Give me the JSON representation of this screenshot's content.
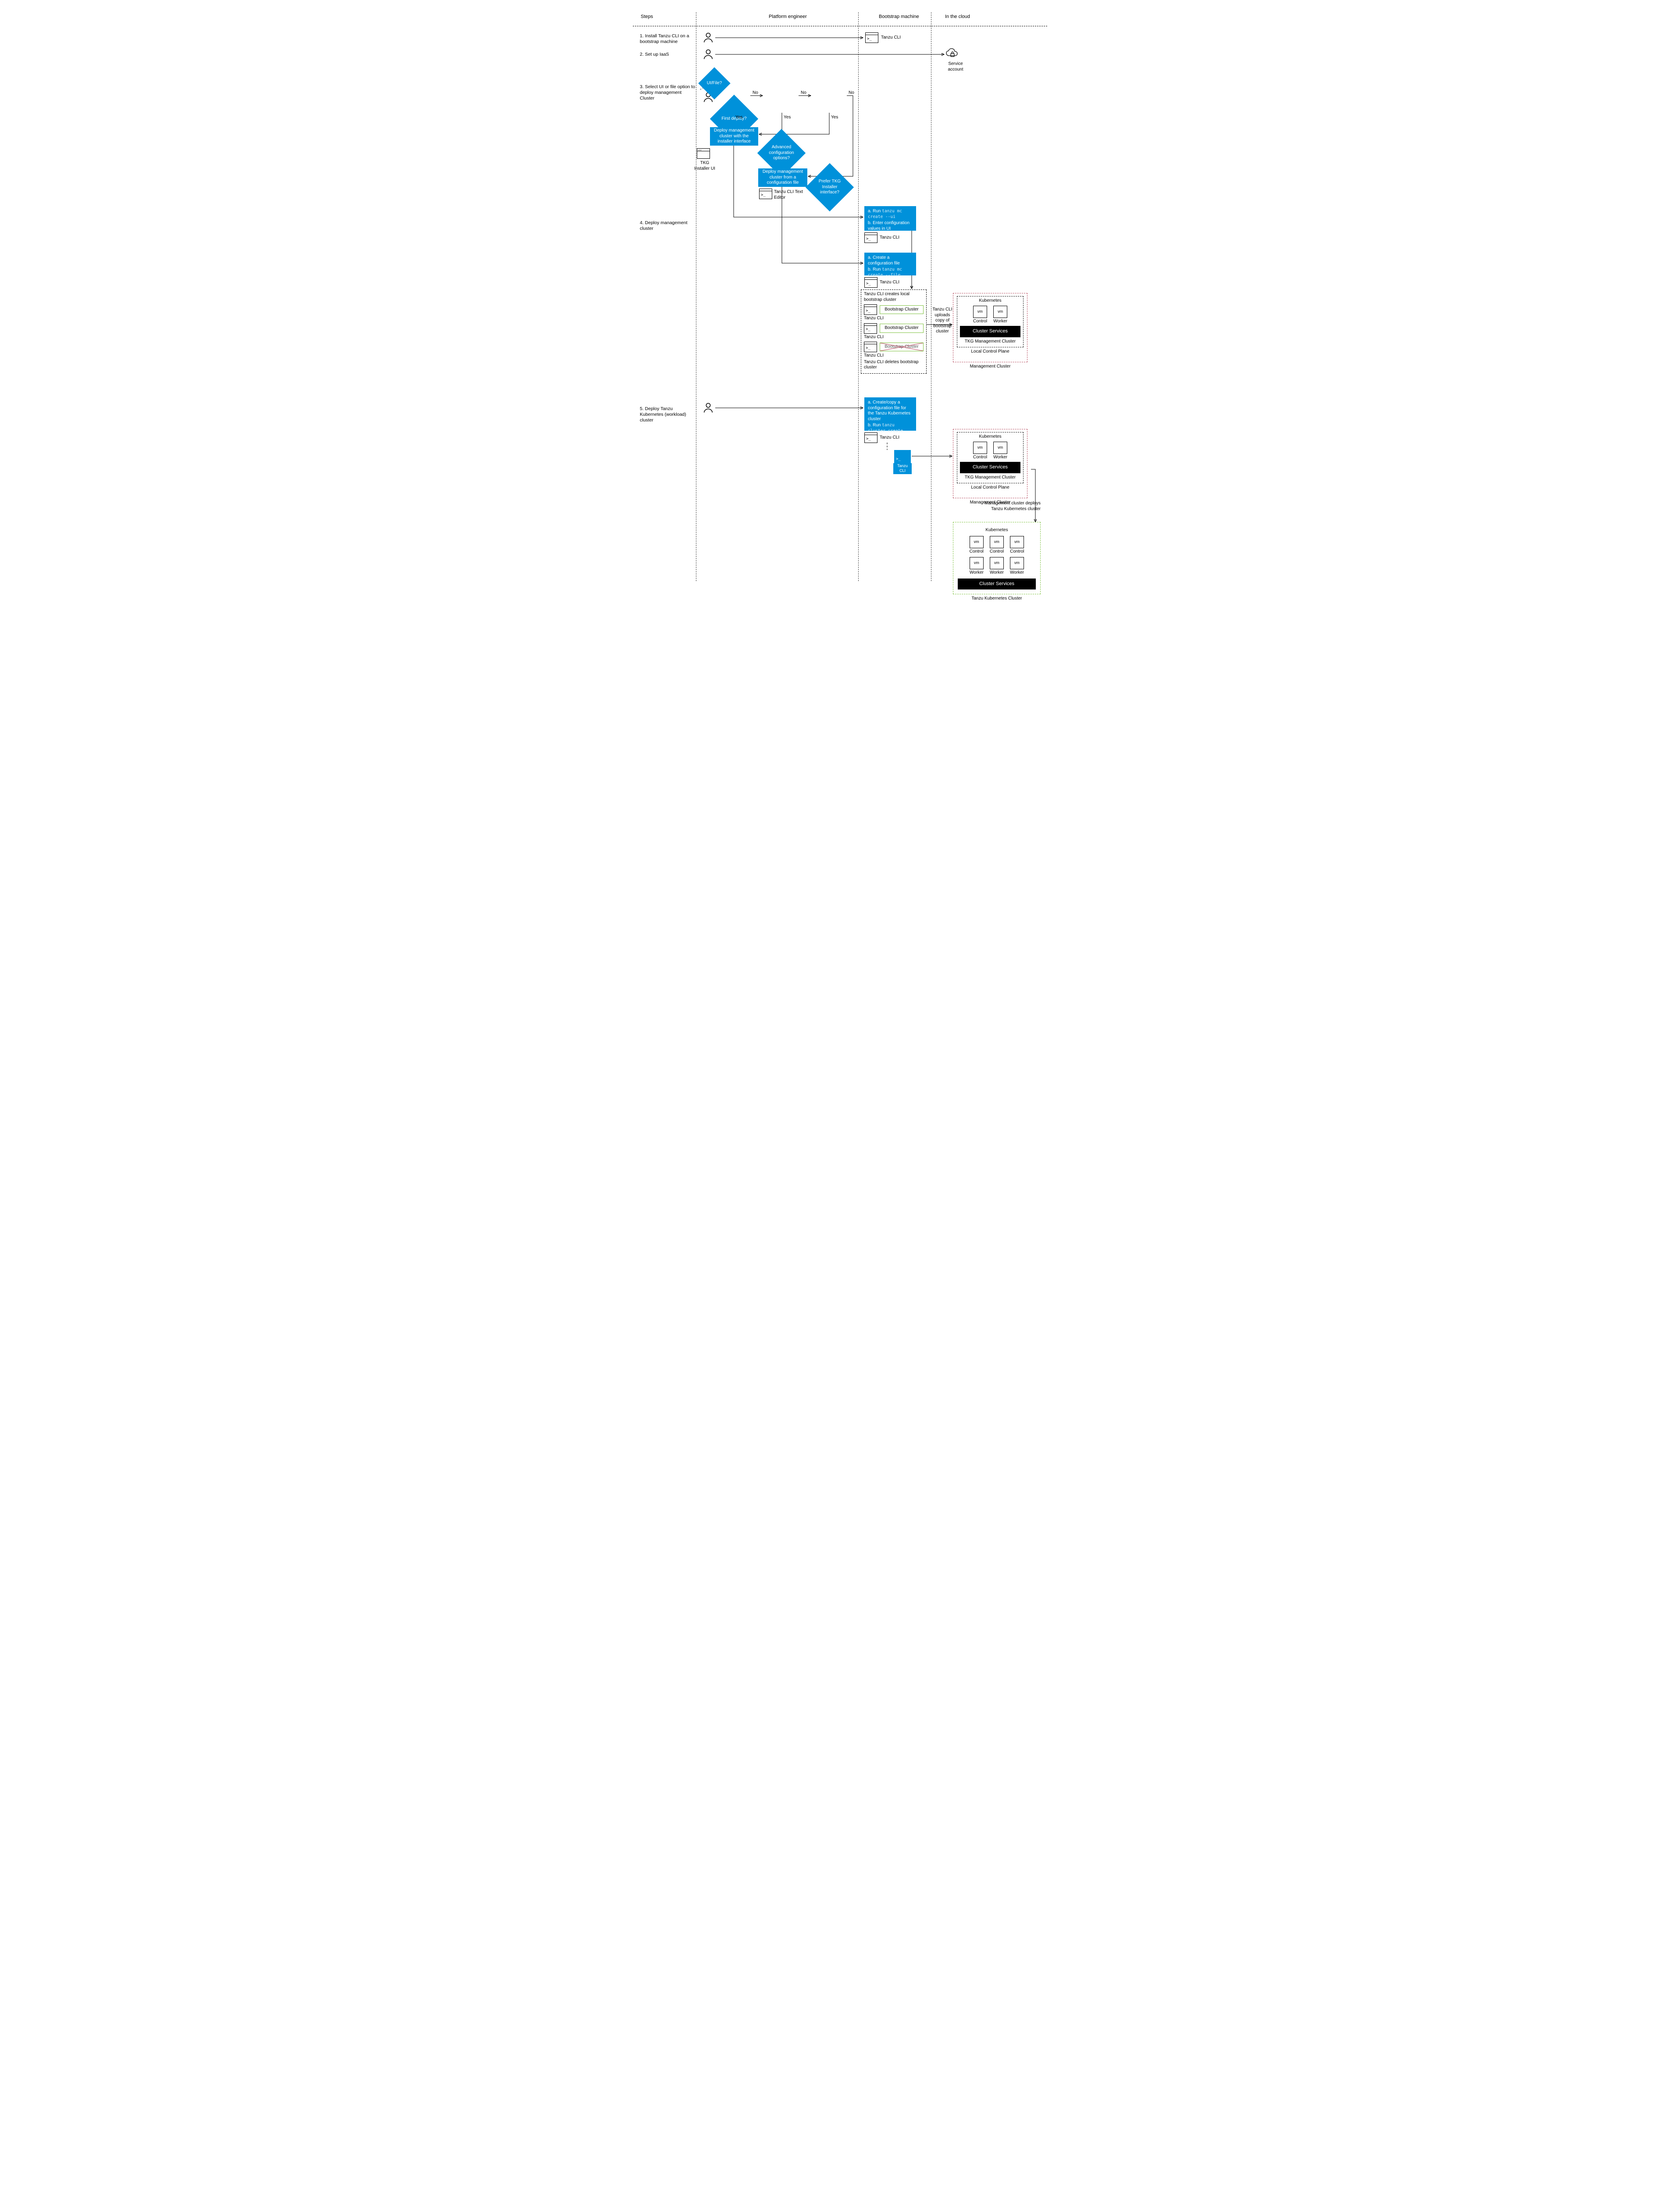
{
  "lanes": {
    "steps": "Steps",
    "pe": "Platform engineer",
    "boot": "Bootstrap machine",
    "cloud": "In the cloud"
  },
  "steps": {
    "s1": "1. Install Tanzu CLI on a bootstrap machine",
    "s2": "2. Set up IaaS",
    "s3": "3. Select UI or file option to deploy management Cluster",
    "s4": "4. Deploy management cluster",
    "s5": "5. Deploy Tanzu Kubernetes (workload) cluster"
  },
  "labels": {
    "tanzu_cli": "Tanzu CLI",
    "service_account": "Service account",
    "ui_file": "UI/File?",
    "first_deploy": "First deploy?",
    "advanced": "Advanced configuration options?",
    "prefer": "Prefer TKG Installer interface?",
    "yes": "Yes",
    "no": "No",
    "deploy_ui": "Deploy management cluster with the installer interface",
    "tkg_installer": "TKG Installer UI",
    "deploy_file": "Deploy management cluster from a configuration file",
    "text_editor": "Tanzu CLI Text Editor",
    "run_ui_a": "a. Run ",
    "run_ui_cmd": "tanzu mc create --ui",
    "run_ui_b": "b. Enter configuration values in UI",
    "run_file_a": "a. Create a configuration file",
    "run_file_b": "b. Run ",
    "run_file_cmd": "tanzu mc create --file",
    "step5_a": "a. Create/copy a configuration file for the Tanzu Kubernetes cluster",
    "step5_b": "b. Run ",
    "step5_cmd": "tanzu cluster create",
    "bootstrap_creates": "Tanzu CLI creates local bootstrap cluster",
    "bootstrap_cluster": "Bootstrap Cluster",
    "bootstrap_deletes": "Tanzu CLI deletes bootstrap cluster",
    "upload_note": "Tanzu CLI uploads copy of bootstrap cluster",
    "kubernetes": "Kubernetes",
    "control": "Control",
    "worker": "Worker",
    "cluster_services": "Cluster Services",
    "tkg_mgmt": "TKG Management Cluster",
    "local_cp": "Local Control Plane",
    "mgmt_cluster": "Management Cluster",
    "deploys_note": "Management cluster deploys Tanzu Kubernetes cluster",
    "tk_cluster": "Tanzu Kubernetes Cluster",
    "vm": "vm"
  }
}
